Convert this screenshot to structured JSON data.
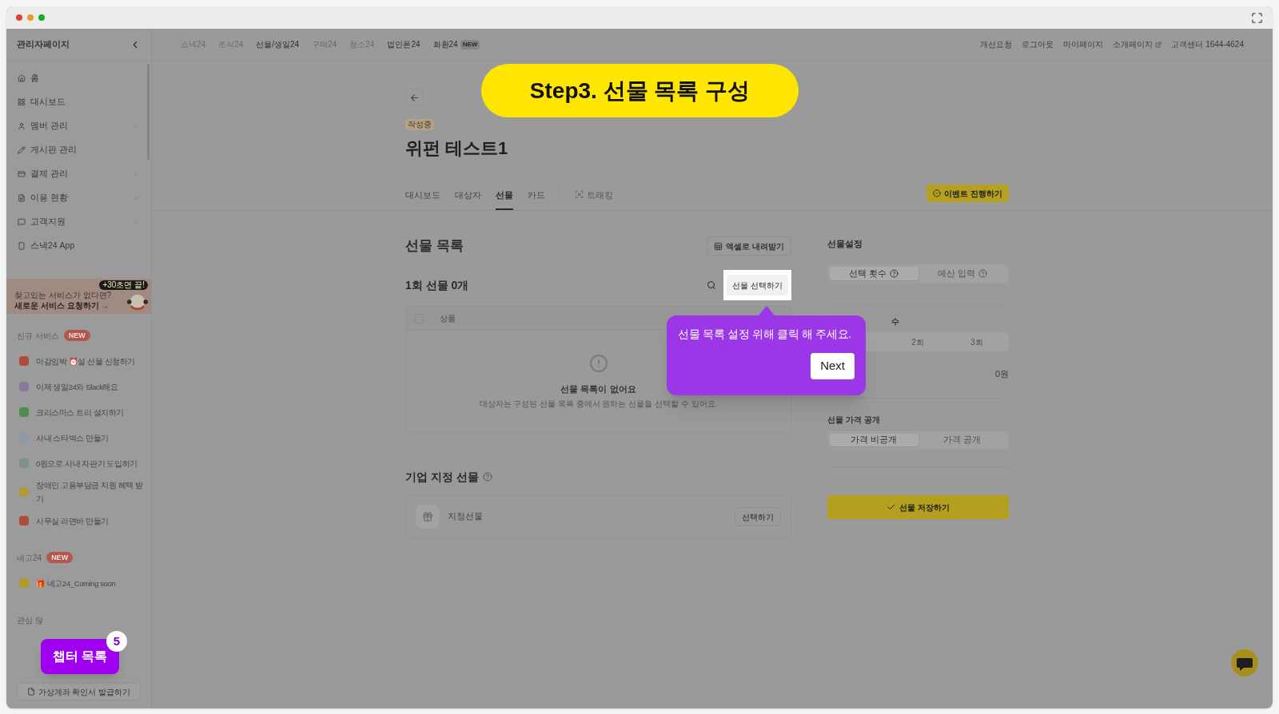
{
  "sidebar": {
    "title": "관리자페이지",
    "menu": [
      {
        "label": "홈",
        "expandable": false
      },
      {
        "label": "대시보드",
        "expandable": false
      },
      {
        "label": "멤버 관리",
        "expandable": true
      },
      {
        "label": "게시판 관리",
        "expandable": false
      },
      {
        "label": "결제 관리",
        "expandable": true
      },
      {
        "label": "이용 현황",
        "expandable": true
      },
      {
        "label": "고객지원",
        "expandable": true
      },
      {
        "label": "스낵24 App",
        "expandable": false
      }
    ],
    "banner": {
      "caption": "찾고있는 서비스가 없다면?",
      "link": "새로운 서비스 요청하기 →",
      "bubble": "+30초면 끝!"
    },
    "sections": [
      {
        "title": "신규 서비스",
        "badge": "NEW",
        "items": [
          {
            "label": "마감임박 ⏰설 선물 신청하기",
            "color": "#b04a3a"
          },
          {
            "label": "이제 생일24와 Slack해요",
            "color": "#8a7a9a"
          },
          {
            "label": "크리스마스 트리 설치하기",
            "color": "#4f8a4f"
          },
          {
            "label": "사내 스타벅스 만들기",
            "color": "#8d9aa6"
          },
          {
            "label": "0원으로 사내 자판기 도입하기",
            "color": "#7f8f8f"
          },
          {
            "label": "장애인 고용부담금 지원 혜택 받기",
            "color": "#b09a3a"
          },
          {
            "label": "사무실 라면바 만들기",
            "color": "#b04a3a"
          }
        ]
      },
      {
        "title": "네고24",
        "badge": "NEW",
        "items": [
          {
            "label": "🎁 네고24_Coming soon",
            "color": "#b39a2a"
          }
        ]
      },
      {
        "title": "관심 많"
      }
    ],
    "bottom_button": "가상계좌 확인서 발급하기"
  },
  "top_nav": {
    "services": [
      {
        "label": "스낵24",
        "muted": true
      },
      {
        "label": "조식24",
        "muted": true
      },
      {
        "label": "선물/생일24",
        "muted": false
      },
      {
        "label": "구매24",
        "muted": true
      },
      {
        "label": "청소24",
        "muted": true
      },
      {
        "label": "법인폰24",
        "muted": false
      },
      {
        "label": "화환24",
        "muted": false,
        "badge": "NEW"
      }
    ],
    "links": [
      {
        "label": "개선요청",
        "external": false
      },
      {
        "label": "로그아웃",
        "external": false
      },
      {
        "label": "마이페이지",
        "external": false
      },
      {
        "label": "소개페이지",
        "external": true
      },
      {
        "label": "고객센터 1644-4624",
        "external": false
      }
    ]
  },
  "event": {
    "status": "작성중",
    "title": "위펀 테스트1",
    "tabs": [
      {
        "label": "대시보드",
        "selected": false,
        "disabled": false
      },
      {
        "label": "대상자",
        "selected": false,
        "disabled": false
      },
      {
        "label": "선물",
        "selected": true,
        "disabled": false
      },
      {
        "label": "카드",
        "selected": false,
        "disabled": false
      },
      {
        "label": "트래킹",
        "selected": false,
        "disabled": true
      }
    ],
    "action_button": "이벤트 진행하기"
  },
  "gift_list": {
    "title": "선물 목록",
    "export_button": "엑셀로 내려받기",
    "round_title": "1회 선물 0개",
    "select_button": "선물 선택하기",
    "select_all_checked": false,
    "column": "상품",
    "empty_title": "선물 목록이 없어요",
    "empty_text": "대상자는 구성된 선물 목록 중에서 원하는 선물을 선택할 수 있어요."
  },
  "company_gift": {
    "title": "기업 지정 선물",
    "item": "지정선물",
    "button": "선택하기"
  },
  "settings": {
    "title": "선물설정",
    "mode": [
      {
        "label": "선택 횟수",
        "selected": true
      },
      {
        "label": "예산 입력",
        "selected": false
      }
    ],
    "label_fragment": "수",
    "rounds": [
      {
        "label": "2회",
        "selected": false
      },
      {
        "label": "3회",
        "selected": false
      }
    ],
    "amount": "0원",
    "price_title": "선물 가격 공개",
    "price": [
      {
        "label": "가격 비공개",
        "selected": true
      },
      {
        "label": "가격 공개",
        "selected": false
      }
    ],
    "save_button": "선물 저장하기"
  },
  "tour": {
    "step_title": "Step3. 선물 목록 구성",
    "tooltip": "선물 목록 설정 위해 클릭 해 주세요.",
    "next": "Next",
    "chapter_button": "챕터 목록",
    "chapter_count": "5"
  }
}
